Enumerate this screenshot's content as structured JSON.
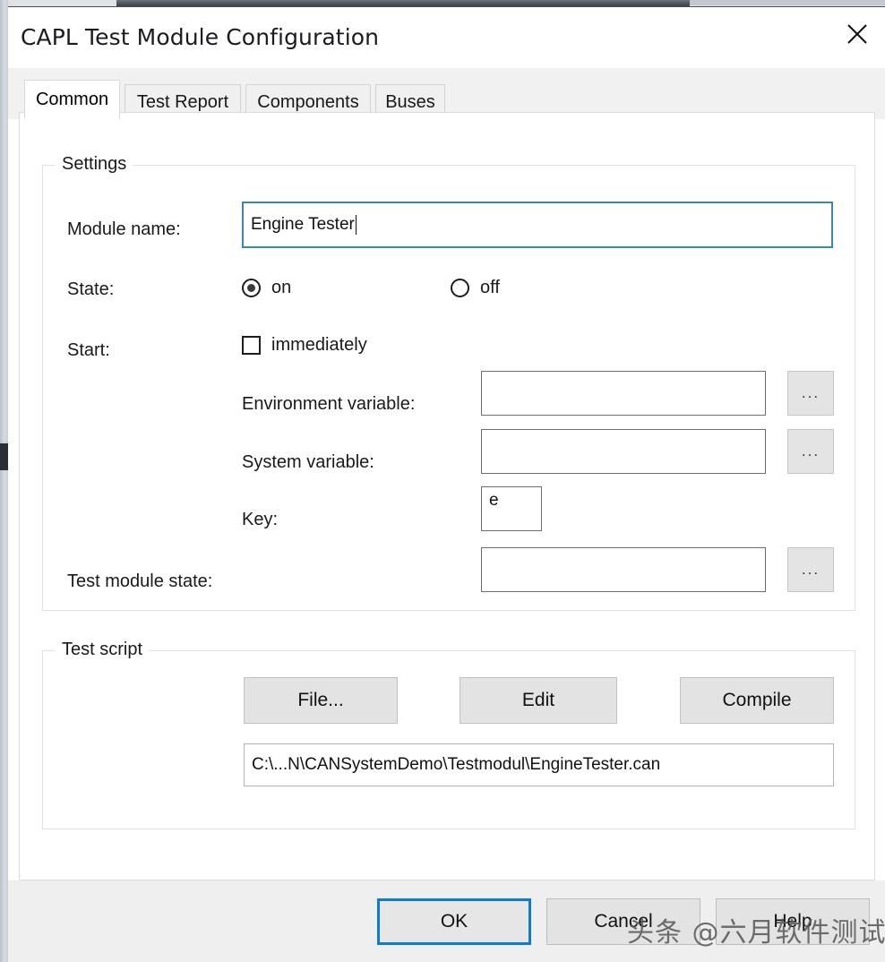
{
  "window": {
    "title": "CAPL Test Module Configuration",
    "close_icon": "close-icon"
  },
  "tabs": [
    {
      "label": "Common",
      "active": true
    },
    {
      "label": "Test Report",
      "active": false
    },
    {
      "label": "Components",
      "active": false
    },
    {
      "label": "Buses",
      "active": false
    }
  ],
  "settings": {
    "group_title": "Settings",
    "module_name": {
      "label": "Module name:",
      "value": "Engine Tester",
      "focused": true
    },
    "state": {
      "label": "State:",
      "options": [
        {
          "label": "on",
          "selected": true
        },
        {
          "label": "off",
          "selected": false
        }
      ]
    },
    "start": {
      "label": "Start:",
      "immediately": {
        "label": "immediately",
        "checked": false
      },
      "environment_variable": {
        "label": "Environment variable:",
        "value": "",
        "browse": "..."
      },
      "system_variable": {
        "label": "System variable:",
        "value": "",
        "browse": "..."
      },
      "key": {
        "label": "Key:",
        "value": "e"
      }
    },
    "test_module_state": {
      "label": "Test module state:",
      "value": "",
      "browse": "..."
    }
  },
  "test_script": {
    "group_title": "Test script",
    "buttons": [
      {
        "label": "File..."
      },
      {
        "label": "Edit"
      },
      {
        "label": "Compile"
      }
    ],
    "path": "C:\\...N\\CANSystemDemo\\Testmodul\\EngineTester.can"
  },
  "footer": {
    "ok": "OK",
    "cancel": "Cancel",
    "help": "Help"
  },
  "watermark": "头条 @六月软件测试",
  "colors": {
    "accent": "#0d7bd4",
    "focus_border": "#3a89a8",
    "dialog_bg": "#ffffff",
    "footer_bg": "#efefef",
    "button_bg": "#e3e3e3"
  }
}
